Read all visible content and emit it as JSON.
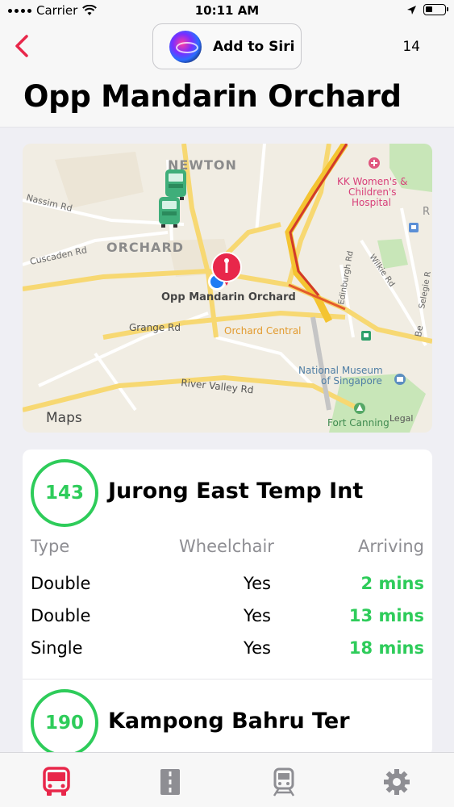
{
  "status_bar": {
    "carrier": "Carrier",
    "time": "10:11 AM"
  },
  "nav": {
    "back_icon": "chevron-left-icon",
    "siri_label": "Add to Siri",
    "right_label": "14",
    "title": "Opp Mandarin Orchard"
  },
  "map": {
    "labels": {
      "newton": "NEWTON",
      "orchard": "ORCHARD",
      "nassim": "Nassim Rd",
      "cuscaden": "Cuscaden Rd",
      "grange": "Grange Rd",
      "river_valley": "River Valley Rd",
      "stop": "Opp Mandarin Orchard",
      "orchard_central": "Orchard Central",
      "hospital_1": "KK Women's &",
      "hospital_2": "Children's",
      "hospital_3": "Hospital",
      "edinburgh": "Edinburgh Rd",
      "wilkie": "Wilkie Rd",
      "selegie": "Selegie R",
      "museum_1": "National Museum",
      "museum_2": "of Singapore",
      "fort_canning": "Fort Canning",
      "legal": "Legal",
      "maps": "Maps",
      "r_edge": "R",
      "be_edge": "Be"
    }
  },
  "services": [
    {
      "number": "143",
      "destination": "Jurong East Temp Int",
      "headers": {
        "type": "Type",
        "wheelchair": "Wheelchair",
        "arriving": "Arriving"
      },
      "rows": [
        {
          "type": "Double",
          "wheelchair": "Yes",
          "arriving": "2 mins"
        },
        {
          "type": "Double",
          "wheelchair": "Yes",
          "arriving": "13 mins"
        },
        {
          "type": "Single",
          "wheelchair": "Yes",
          "arriving": "18 mins"
        }
      ]
    },
    {
      "number": "190",
      "destination": "Kampong Bahru Ter"
    }
  ],
  "tabbar": {
    "items": [
      "bus-icon",
      "road-icon",
      "train-icon",
      "gear-icon"
    ],
    "active": "bus-icon",
    "accent": "#e8274a"
  },
  "colors": {
    "accent": "#e8274a",
    "arrival_green": "#2ecc5a"
  }
}
